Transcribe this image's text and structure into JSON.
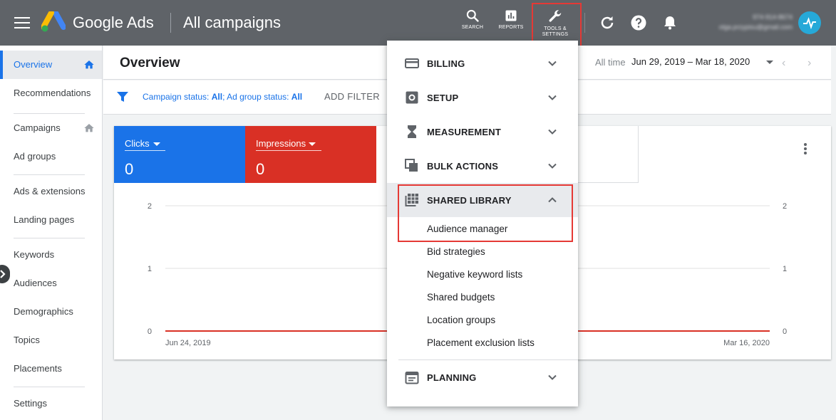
{
  "topbar": {
    "brand": "Google Ads",
    "page_title": "All campaigns",
    "tools": {
      "search": "SEARCH",
      "reports": "REPORTS",
      "tools_settings_line1": "TOOLS &",
      "tools_settings_line2": "SETTINGS"
    },
    "account_line1": "974-914-8674",
    "account_line2": "olga.przypisu@gmail.com"
  },
  "sidebar": {
    "items": [
      {
        "label": "Overview"
      },
      {
        "label": "Recommendations"
      },
      {
        "label": "Campaigns"
      },
      {
        "label": "Ad groups"
      },
      {
        "label": "Ads & extensions"
      },
      {
        "label": "Landing pages"
      },
      {
        "label": "Keywords"
      },
      {
        "label": "Audiences"
      },
      {
        "label": "Demographics"
      },
      {
        "label": "Topics"
      },
      {
        "label": "Placements"
      },
      {
        "label": "Settings"
      }
    ]
  },
  "header": {
    "title": "Overview",
    "all_time": "All time",
    "date_range": "Jun 29, 2019 – Mar 18, 2020"
  },
  "filter": {
    "campaign_status_prefix": "Campaign status: ",
    "campaign_status_value": "All",
    "ad_group_status_prefix": "; Ad group status: ",
    "ad_group_status_value": "All",
    "add_filter": "ADD FILTER"
  },
  "metrics": [
    {
      "label": "Clicks",
      "value": "0",
      "color": "#1a73e8"
    },
    {
      "label": "Impressions",
      "value": "0",
      "color": "#d93025"
    }
  ],
  "chart_data": {
    "type": "line",
    "x": [
      "Jun 24, 2019",
      "Mar 16, 2020"
    ],
    "series": [
      {
        "values": [
          0,
          0
        ],
        "color": "#d93025"
      }
    ],
    "y_ticks": [
      "0",
      "1",
      "2"
    ],
    "ylim": [
      0,
      2
    ],
    "grid": true
  },
  "dropdown": {
    "billing": "BILLING",
    "setup": "SETUP",
    "measurement": "MEASUREMENT",
    "bulk_actions": "BULK ACTIONS",
    "shared_library": "SHARED LIBRARY",
    "shared_items": [
      "Audience manager",
      "Bid strategies",
      "Negative keyword lists",
      "Shared budgets",
      "Location groups",
      "Placement exclusion lists"
    ],
    "planning": "PLANNING"
  },
  "colors": {
    "highlight": "#e53935",
    "accent": "#1a73e8"
  }
}
